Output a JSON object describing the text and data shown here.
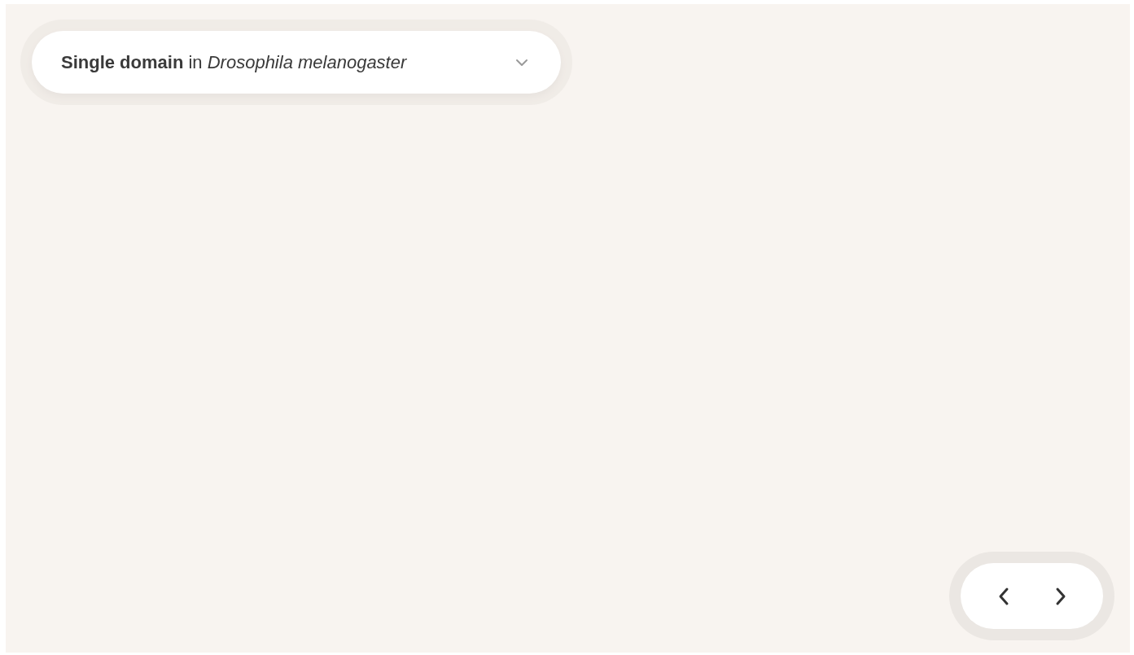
{
  "selector": {
    "label": "**Single domain** in *Drosophila melanogaster*"
  }
}
